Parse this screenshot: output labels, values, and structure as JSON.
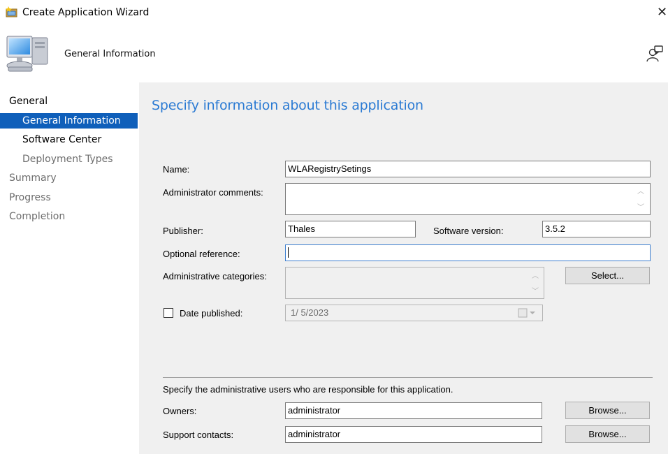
{
  "window": {
    "title": "Create Application Wizard",
    "close_glyph": "✕"
  },
  "header": {
    "title": "General Information"
  },
  "nav": {
    "items": [
      {
        "label": "General"
      },
      {
        "label": "General Information"
      },
      {
        "label": "Software Center"
      },
      {
        "label": "Deployment Types"
      },
      {
        "label": "Summary"
      },
      {
        "label": "Progress"
      },
      {
        "label": "Completion"
      }
    ]
  },
  "form": {
    "heading": "Specify information about this application",
    "name_label": "Name:",
    "name_value": "WLARegistrySetings",
    "comments_label": "Administrator comments:",
    "comments_value": "",
    "publisher_label": "Publisher:",
    "publisher_value": "Thales",
    "version_label": "Software version:",
    "version_value": "3.5.2",
    "optref_label": "Optional reference:",
    "optref_value": "",
    "categories_label": "Administrative categories:",
    "select_button": "Select...",
    "date_label": "Date published:",
    "date_value": "1/  5/2023",
    "date_checked": false
  },
  "owners_section": {
    "description": "Specify the administrative users who are responsible for this application.",
    "owners_label": "Owners:",
    "owners_value": "administrator",
    "support_label": "Support contacts:",
    "support_value": "administrator",
    "browse_button": "Browse..."
  }
}
